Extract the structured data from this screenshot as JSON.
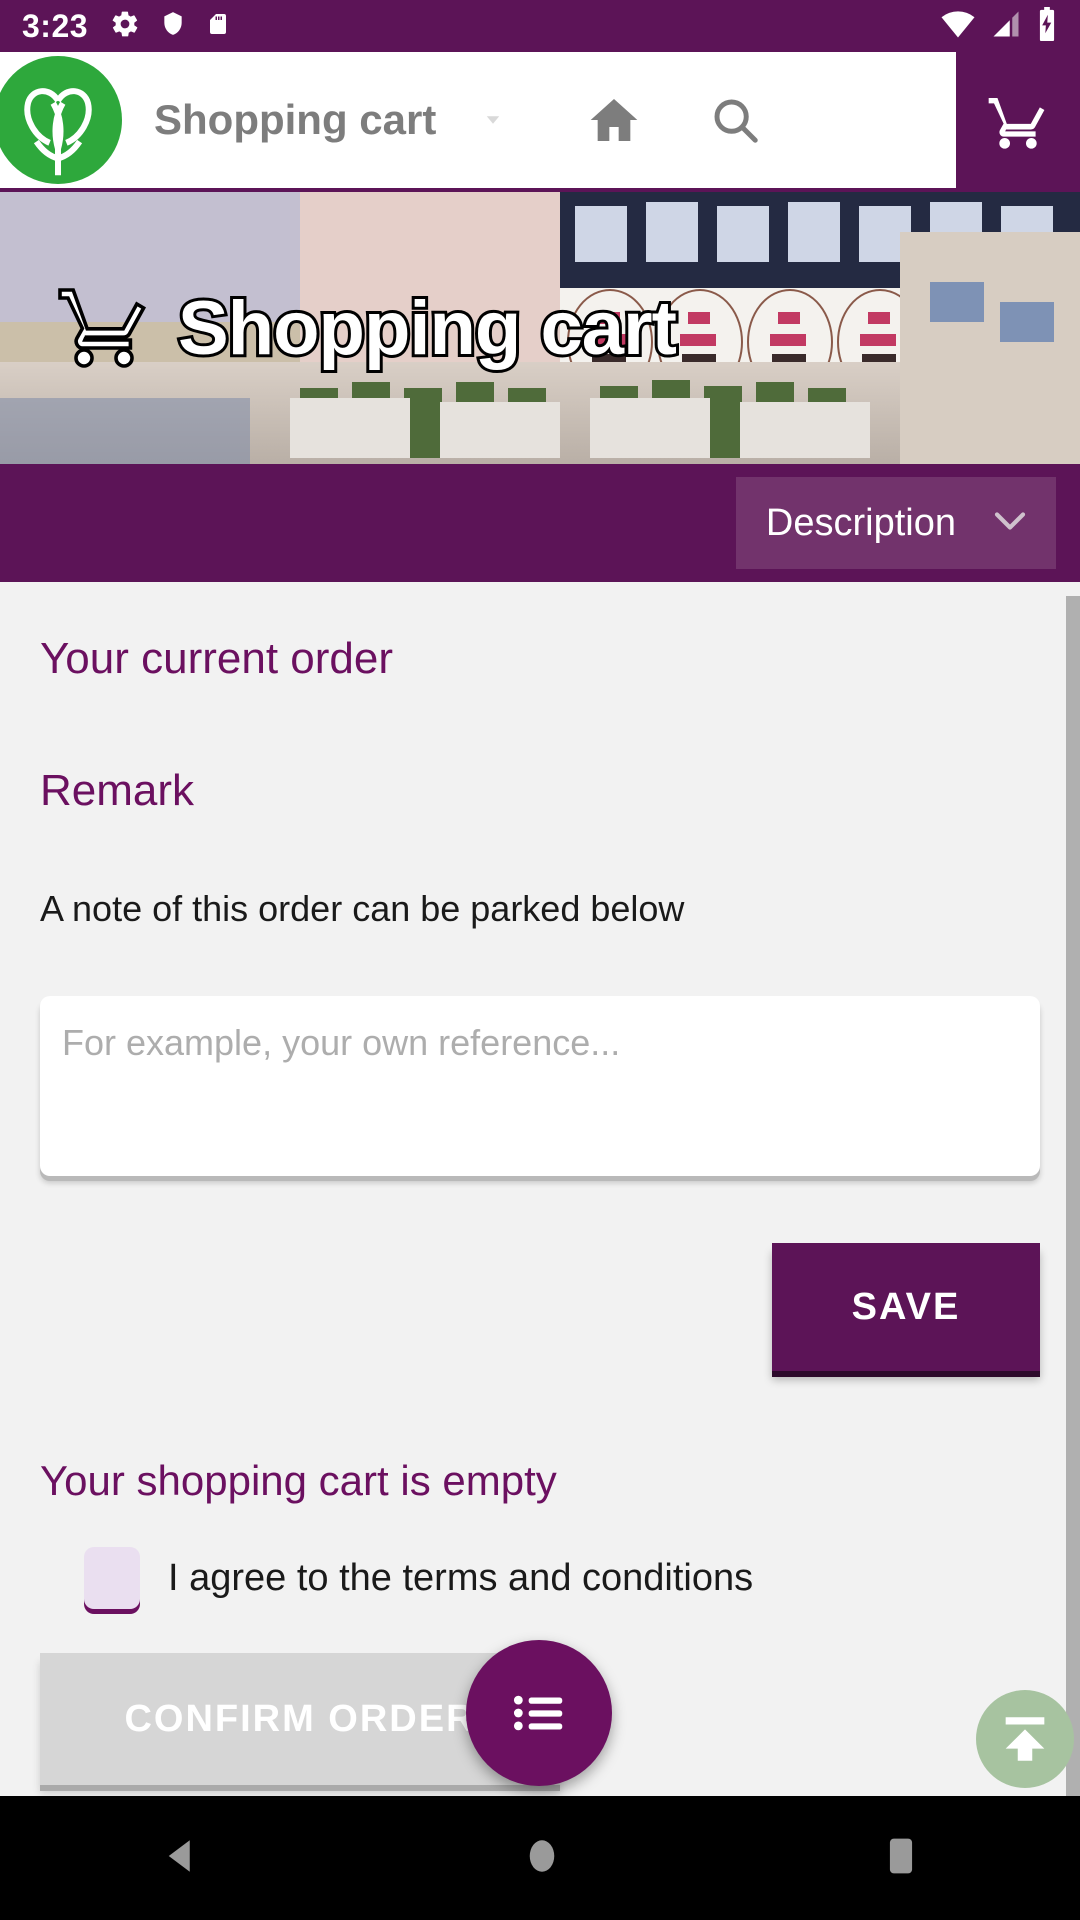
{
  "status_bar": {
    "time": "3:23",
    "left_icons": [
      "gear-icon",
      "shield-icon",
      "sd-card-icon"
    ],
    "right_icons": [
      "wifi-icon",
      "signal-icon",
      "battery-charging-icon"
    ],
    "background_color": "#5c1457"
  },
  "app_bar": {
    "logo_name": "tulip-logo",
    "title": "Shopping cart",
    "chevron": "chevron-down-icon",
    "home": "home-icon",
    "search": "search-icon",
    "cart": "shopping-cart-icon"
  },
  "hero": {
    "title": "Shopping cart",
    "icon": "shopping-cart-icon",
    "alt": "flower auction hall"
  },
  "description_bar": {
    "label": "Description",
    "chevron": "chevron-down-icon",
    "bar_color": "#5c1457",
    "button_color": "#72336c"
  },
  "main": {
    "current_order_heading": "Your current order",
    "remark_heading": "Remark",
    "remark_description": "A note of this order can be parked below",
    "remark_placeholder": "For example, your own reference...",
    "remark_value": "",
    "save_label": "SAVE",
    "cart_empty_message": "Your shopping cart is empty",
    "terms_label": "I agree to the terms and conditions",
    "terms_checked": false,
    "confirm_label": "CONFIRM ORDER",
    "confirm_enabled": false
  },
  "floating": {
    "menu_icon": "list-menu-icon",
    "scroll_top_icon": "scroll-to-top-icon"
  },
  "nav_bar": {
    "back": "back-triangle-icon",
    "home": "home-circle-icon",
    "recents": "recents-square-icon"
  },
  "colors": {
    "primary_purple": "#5c1457",
    "heading_purple": "#6b1060",
    "accent_green": "#2ea83c",
    "page_background": "#f2f2f2"
  }
}
